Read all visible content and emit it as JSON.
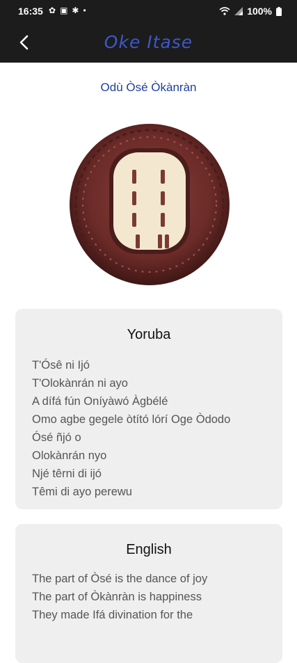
{
  "status": {
    "time": "16:35",
    "left_icons": [
      "flower-icon",
      "image-icon",
      "bug-icon",
      "dot-icon"
    ],
    "battery": "100%"
  },
  "appbar": {
    "title": "Oke Itase"
  },
  "odu": {
    "title": "Odù Òsé Òkànràn"
  },
  "colors": {
    "accent": "#3b59c9",
    "appbar_bg": "#1c1c1c",
    "card_bg": "#efefef",
    "tray": "#6b2b28"
  },
  "yoruba": {
    "heading": "Yoruba",
    "lines": [
      "T'Ósê ni Ijó",
      "T'Olokànrán ni ayo",
      "A dífá fún Oníyàwó Àgbélé",
      "Omo agbe gegele òtító lórí Oge Òdodo",
      "Ósé ñjó o",
      "Olokànrán nyo",
      "Njé têrni di ijó",
      "Têmi di ayo perewu"
    ]
  },
  "english": {
    "heading": "English",
    "lines": [
      "The part of Òsé is the dance of joy",
      "The part of Òkànràn is happiness",
      "They made Ifá divination for the"
    ]
  }
}
